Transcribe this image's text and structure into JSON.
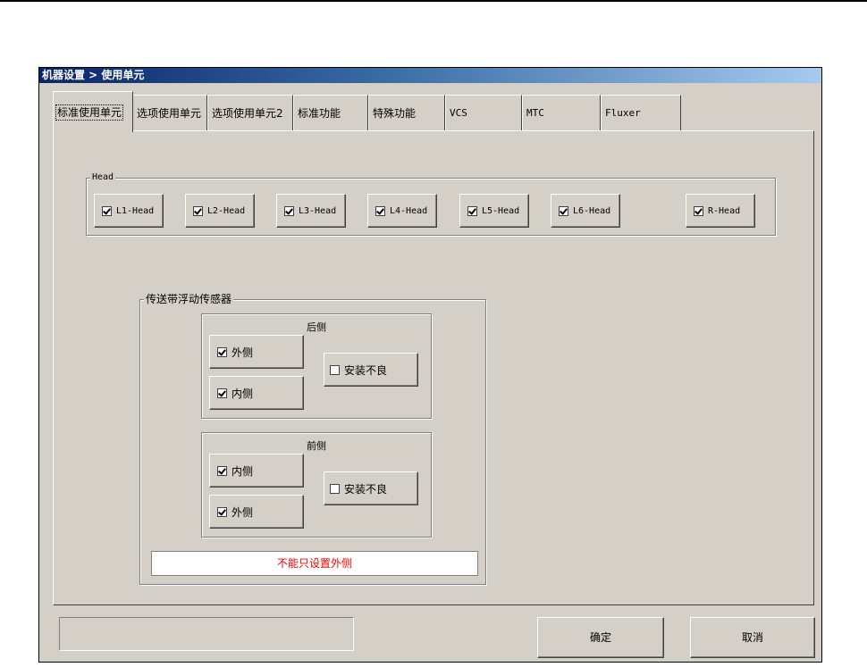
{
  "window": {
    "title": "机器设置 > 使用单元"
  },
  "tabs": [
    {
      "label": "标准使用单元",
      "active": true
    },
    {
      "label": "选项使用单元"
    },
    {
      "label": "选项使用单元2"
    },
    {
      "label": "标准功能"
    },
    {
      "label": "特殊功能"
    },
    {
      "label": "VCS"
    },
    {
      "label": "MTC"
    },
    {
      "label": "Fluxer"
    }
  ],
  "head_group": {
    "legend": "Head",
    "items": [
      {
        "label": "L1-Head",
        "checked": true
      },
      {
        "label": "L2-Head",
        "checked": true
      },
      {
        "label": "L3-Head",
        "checked": true
      },
      {
        "label": "L4-Head",
        "checked": true
      },
      {
        "label": "L5-Head",
        "checked": true
      },
      {
        "label": "L6-Head",
        "checked": true
      },
      {
        "label": "R-Head",
        "checked": true
      }
    ]
  },
  "conveyor_group": {
    "legend": "传送带浮动传感器",
    "rear": {
      "caption": "后侧",
      "outer": {
        "label": "外侧",
        "checked": true
      },
      "inner": {
        "label": "内侧",
        "checked": true
      },
      "bad": {
        "label": "安装不良",
        "checked": false
      }
    },
    "front": {
      "caption": "前侧",
      "inner": {
        "label": "内侧",
        "checked": true
      },
      "outer": {
        "label": "外侧",
        "checked": true
      },
      "bad": {
        "label": "安装不良",
        "checked": false
      }
    },
    "message": "不能只设置外侧"
  },
  "footer": {
    "ok_label": "确定",
    "cancel_label": "取消"
  },
  "colors": {
    "title_start": "#0a246a",
    "title_end": "#a6caf0",
    "face": "#d4d0c8",
    "message_text": "#ff0000"
  }
}
